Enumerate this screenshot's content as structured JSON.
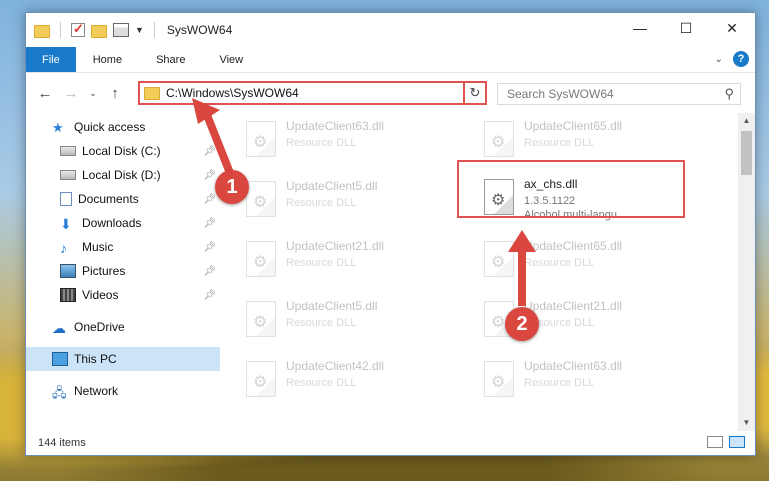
{
  "window": {
    "title": "SysWOW64",
    "controls": {
      "minimize": "—",
      "maximize": "☐",
      "close": "✕"
    }
  },
  "ribbon": {
    "tabs": [
      "File",
      "Home",
      "Share",
      "View"
    ],
    "help": "?",
    "collapse": "⌄"
  },
  "nav": {
    "back": "←",
    "forward": "→",
    "recent": "⌄",
    "up": "↑",
    "address": "C:\\Windows\\SysWOW64",
    "address_dropdown": "⌄",
    "refresh": "↻",
    "search_placeholder": "Search SysWOW64",
    "search_icon": "⚲"
  },
  "sidebar": {
    "items": [
      {
        "label": "Quick access",
        "icon": "star-icon",
        "pinned": false
      },
      {
        "label": "Local Disk (C:)",
        "icon": "drive-icon",
        "pinned": true
      },
      {
        "label": "Local Disk (D:)",
        "icon": "drive-icon",
        "pinned": true
      },
      {
        "label": "Documents",
        "icon": "documents-icon",
        "pinned": true
      },
      {
        "label": "Downloads",
        "icon": "downloads-icon",
        "pinned": true
      },
      {
        "label": "Music",
        "icon": "music-icon",
        "pinned": true
      },
      {
        "label": "Pictures",
        "icon": "pictures-icon",
        "pinned": true
      },
      {
        "label": "Videos",
        "icon": "videos-icon",
        "pinned": true
      },
      {
        "label": "OneDrive",
        "icon": "cloud-icon",
        "pinned": false
      },
      {
        "label": "This PC",
        "icon": "pc-icon",
        "pinned": false
      },
      {
        "label": "Network",
        "icon": "network-icon",
        "pinned": false
      }
    ]
  },
  "files": [
    {
      "name": "UpdateClient63.dll",
      "sub": "Resource DLL",
      "desc": ""
    },
    {
      "name": "UpdateClient65.dll",
      "sub": "Resource DLL",
      "desc": ""
    },
    {
      "name": "UpdateClient5.dll",
      "sub": "Resource DLL",
      "desc": ""
    },
    {
      "name": "ax_chs.dll",
      "sub": "1.3.5.1122",
      "desc": "Alcohol multi-langu..."
    },
    {
      "name": "UpdateClient21.dll",
      "sub": "Resource DLL",
      "desc": ""
    },
    {
      "name": "UpdateClient65.dll",
      "sub": "Resource DLL",
      "desc": ""
    },
    {
      "name": "UpdateClient5.dll",
      "sub": "Resource DLL",
      "desc": ""
    },
    {
      "name": "UpdateClient21.dll",
      "sub": "Resource DLL",
      "desc": ""
    },
    {
      "name": "UpdateClient42.dll",
      "sub": "Resource DLL",
      "desc": ""
    },
    {
      "name": "UpdateClient63.dll",
      "sub": "Resource DLL",
      "desc": ""
    }
  ],
  "status": {
    "count": "144 items"
  },
  "callouts": {
    "one": "1",
    "two": "2"
  },
  "colors": {
    "accent": "#1979ca",
    "highlight": "#e05252",
    "badge": "#d9473f"
  }
}
